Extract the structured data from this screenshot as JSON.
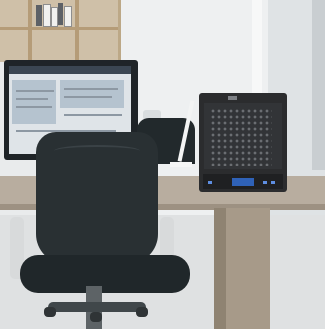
{
  "scene": {
    "type": "office-photo",
    "subject": "network-attached-storage-device",
    "objects": [
      "bookshelf",
      "monitor",
      "desk-lamp",
      "office-chair",
      "desk",
      "nas-server"
    ]
  },
  "colors": {
    "wall": "#eef0f1",
    "desk": "#b8ad9f",
    "chair": "#293033",
    "nas": "#2b2c2e",
    "nas_display": "#2f62b8"
  }
}
